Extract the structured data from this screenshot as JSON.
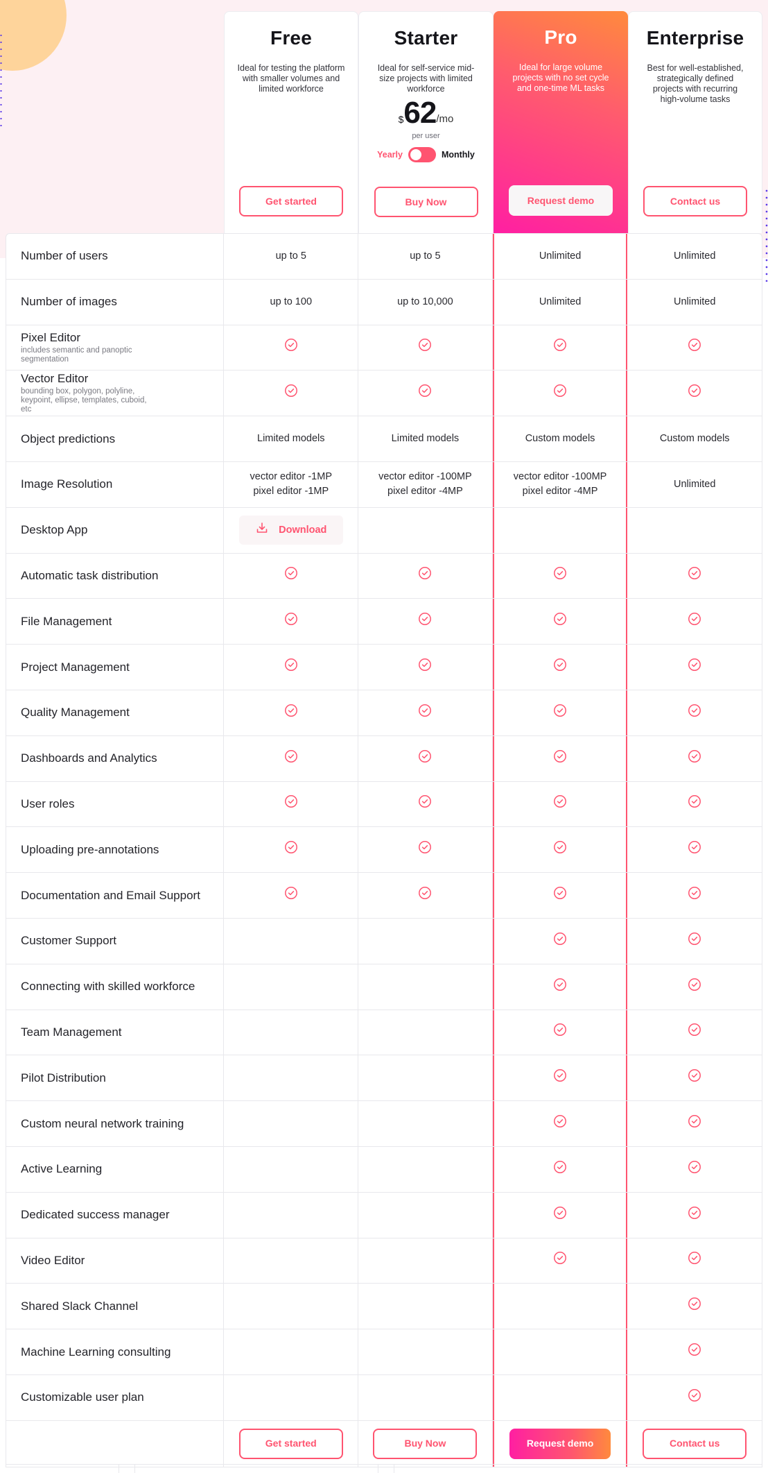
{
  "colors": {
    "accent": "#ff5470",
    "pro_gradient_start": "#ff1fa2",
    "pro_gradient_end": "#ff8a3d",
    "hero_bg": "#fdf0f3"
  },
  "plans": [
    {
      "name": "Free",
      "description": "Ideal for testing the platform with smaller volumes and limited workforce",
      "cta": "Get started"
    },
    {
      "name": "Starter",
      "description": "Ideal for self-service mid-size projects with limited workforce",
      "cta": "Buy Now",
      "price": {
        "currency": "$",
        "amount": "62",
        "period": "/mo",
        "unit": "per user"
      },
      "billing": {
        "yearly_label": "Yearly",
        "monthly_label": "Monthly",
        "selected": "Yearly"
      }
    },
    {
      "name": "Pro",
      "description": "Ideal for large volume projects with no set cycle and one-time ML tasks",
      "cta": "Request demo",
      "highlighted": true
    },
    {
      "name": "Enterprise",
      "description": "Best for well-established, strategically defined projects with recurring high-volume tasks",
      "cta": "Contact us"
    }
  ],
  "features": [
    {
      "name": "Number of users",
      "values": [
        "up to 5",
        "up to 5",
        "Unlimited",
        "Unlimited"
      ]
    },
    {
      "name": "Number of images",
      "values": [
        "up to 100",
        "up to 10,000",
        "Unlimited",
        "Unlimited"
      ]
    },
    {
      "name": "Pixel Editor",
      "sub": "includes semantic and panoptic segmentation",
      "values": [
        true,
        true,
        true,
        true
      ]
    },
    {
      "name": "Vector Editor",
      "sub": "bounding box, polygon, polyline, keypoint, ellipse, templates, cuboid, etc",
      "values": [
        true,
        true,
        true,
        true
      ]
    },
    {
      "name": "Object predictions",
      "values": [
        "Limited models",
        "Limited models",
        "Custom models",
        "Custom models"
      ]
    },
    {
      "name": "Image Resolution",
      "values": [
        "vector editor -1MP\npixel editor -1MP",
        "vector editor -100MP\npixel editor -4MP",
        "vector editor -100MP\npixel editor -4MP",
        "Unlimited"
      ]
    },
    {
      "name": "Desktop App",
      "values": [
        {
          "download": "Download"
        },
        false,
        false,
        false
      ]
    },
    {
      "name": "Automatic task distribution",
      "values": [
        true,
        true,
        true,
        true
      ]
    },
    {
      "name": "File Management",
      "values": [
        true,
        true,
        true,
        true
      ]
    },
    {
      "name": "Project Management",
      "values": [
        true,
        true,
        true,
        true
      ]
    },
    {
      "name": "Quality Management",
      "values": [
        true,
        true,
        true,
        true
      ]
    },
    {
      "name": "Dashboards and Analytics",
      "values": [
        true,
        true,
        true,
        true
      ]
    },
    {
      "name": "User roles",
      "values": [
        true,
        true,
        true,
        true
      ]
    },
    {
      "name": "Uploading pre-annotations",
      "values": [
        true,
        true,
        true,
        true
      ]
    },
    {
      "name": "Documentation and Email Support",
      "values": [
        true,
        true,
        true,
        true
      ]
    },
    {
      "name": "Customer Support",
      "values": [
        false,
        false,
        true,
        true
      ]
    },
    {
      "name": "Connecting with skilled workforce",
      "values": [
        false,
        false,
        true,
        true
      ]
    },
    {
      "name": "Team Management",
      "values": [
        false,
        false,
        true,
        true
      ]
    },
    {
      "name": "Pilot Distribution",
      "values": [
        false,
        false,
        true,
        true
      ]
    },
    {
      "name": "Custom neural network training",
      "values": [
        false,
        false,
        true,
        true
      ]
    },
    {
      "name": "Active Learning",
      "values": [
        false,
        false,
        true,
        true
      ]
    },
    {
      "name": "Dedicated success manager",
      "values": [
        false,
        false,
        true,
        true
      ]
    },
    {
      "name": "Video Editor",
      "values": [
        false,
        false,
        true,
        true
      ]
    },
    {
      "name": "Shared Slack Channel",
      "values": [
        false,
        false,
        false,
        true
      ]
    },
    {
      "name": "Machine Learning consulting",
      "values": [
        false,
        false,
        false,
        true
      ]
    },
    {
      "name": "Customizable user plan",
      "values": [
        false,
        false,
        false,
        true
      ]
    }
  ],
  "footer_ctas": [
    "Get started",
    "Buy Now",
    "Request demo",
    "Contact us"
  ]
}
